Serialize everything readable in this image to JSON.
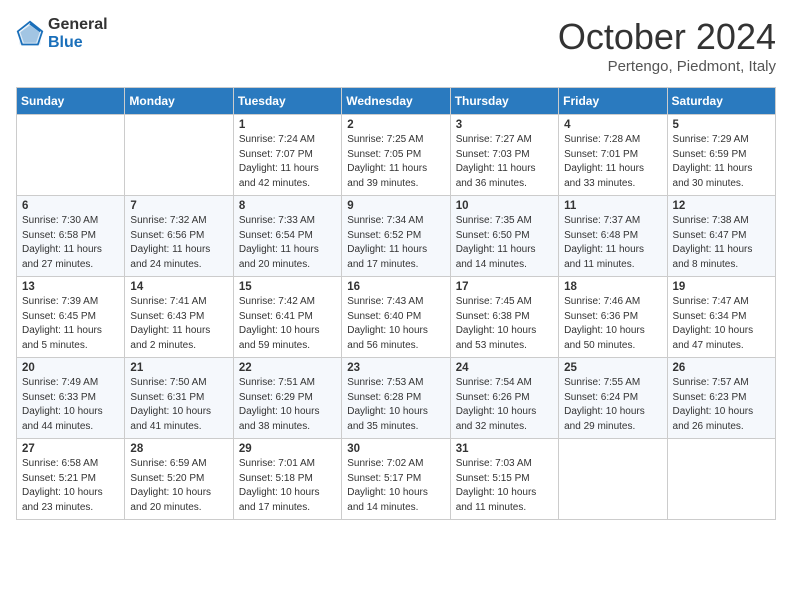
{
  "header": {
    "logo_general": "General",
    "logo_blue": "Blue",
    "title": "October 2024",
    "location": "Pertengo, Piedmont, Italy"
  },
  "columns": [
    "Sunday",
    "Monday",
    "Tuesday",
    "Wednesday",
    "Thursday",
    "Friday",
    "Saturday"
  ],
  "weeks": [
    [
      {
        "day": "",
        "lines": []
      },
      {
        "day": "",
        "lines": []
      },
      {
        "day": "1",
        "lines": [
          "Sunrise: 7:24 AM",
          "Sunset: 7:07 PM",
          "Daylight: 11 hours",
          "and 42 minutes."
        ]
      },
      {
        "day": "2",
        "lines": [
          "Sunrise: 7:25 AM",
          "Sunset: 7:05 PM",
          "Daylight: 11 hours",
          "and 39 minutes."
        ]
      },
      {
        "day": "3",
        "lines": [
          "Sunrise: 7:27 AM",
          "Sunset: 7:03 PM",
          "Daylight: 11 hours",
          "and 36 minutes."
        ]
      },
      {
        "day": "4",
        "lines": [
          "Sunrise: 7:28 AM",
          "Sunset: 7:01 PM",
          "Daylight: 11 hours",
          "and 33 minutes."
        ]
      },
      {
        "day": "5",
        "lines": [
          "Sunrise: 7:29 AM",
          "Sunset: 6:59 PM",
          "Daylight: 11 hours",
          "and 30 minutes."
        ]
      }
    ],
    [
      {
        "day": "6",
        "lines": [
          "Sunrise: 7:30 AM",
          "Sunset: 6:58 PM",
          "Daylight: 11 hours",
          "and 27 minutes."
        ]
      },
      {
        "day": "7",
        "lines": [
          "Sunrise: 7:32 AM",
          "Sunset: 6:56 PM",
          "Daylight: 11 hours",
          "and 24 minutes."
        ]
      },
      {
        "day": "8",
        "lines": [
          "Sunrise: 7:33 AM",
          "Sunset: 6:54 PM",
          "Daylight: 11 hours",
          "and 20 minutes."
        ]
      },
      {
        "day": "9",
        "lines": [
          "Sunrise: 7:34 AM",
          "Sunset: 6:52 PM",
          "Daylight: 11 hours",
          "and 17 minutes."
        ]
      },
      {
        "day": "10",
        "lines": [
          "Sunrise: 7:35 AM",
          "Sunset: 6:50 PM",
          "Daylight: 11 hours",
          "and 14 minutes."
        ]
      },
      {
        "day": "11",
        "lines": [
          "Sunrise: 7:37 AM",
          "Sunset: 6:48 PM",
          "Daylight: 11 hours",
          "and 11 minutes."
        ]
      },
      {
        "day": "12",
        "lines": [
          "Sunrise: 7:38 AM",
          "Sunset: 6:47 PM",
          "Daylight: 11 hours",
          "and 8 minutes."
        ]
      }
    ],
    [
      {
        "day": "13",
        "lines": [
          "Sunrise: 7:39 AM",
          "Sunset: 6:45 PM",
          "Daylight: 11 hours",
          "and 5 minutes."
        ]
      },
      {
        "day": "14",
        "lines": [
          "Sunrise: 7:41 AM",
          "Sunset: 6:43 PM",
          "Daylight: 11 hours",
          "and 2 minutes."
        ]
      },
      {
        "day": "15",
        "lines": [
          "Sunrise: 7:42 AM",
          "Sunset: 6:41 PM",
          "Daylight: 10 hours",
          "and 59 minutes."
        ]
      },
      {
        "day": "16",
        "lines": [
          "Sunrise: 7:43 AM",
          "Sunset: 6:40 PM",
          "Daylight: 10 hours",
          "and 56 minutes."
        ]
      },
      {
        "day": "17",
        "lines": [
          "Sunrise: 7:45 AM",
          "Sunset: 6:38 PM",
          "Daylight: 10 hours",
          "and 53 minutes."
        ]
      },
      {
        "day": "18",
        "lines": [
          "Sunrise: 7:46 AM",
          "Sunset: 6:36 PM",
          "Daylight: 10 hours",
          "and 50 minutes."
        ]
      },
      {
        "day": "19",
        "lines": [
          "Sunrise: 7:47 AM",
          "Sunset: 6:34 PM",
          "Daylight: 10 hours",
          "and 47 minutes."
        ]
      }
    ],
    [
      {
        "day": "20",
        "lines": [
          "Sunrise: 7:49 AM",
          "Sunset: 6:33 PM",
          "Daylight: 10 hours",
          "and 44 minutes."
        ]
      },
      {
        "day": "21",
        "lines": [
          "Sunrise: 7:50 AM",
          "Sunset: 6:31 PM",
          "Daylight: 10 hours",
          "and 41 minutes."
        ]
      },
      {
        "day": "22",
        "lines": [
          "Sunrise: 7:51 AM",
          "Sunset: 6:29 PM",
          "Daylight: 10 hours",
          "and 38 minutes."
        ]
      },
      {
        "day": "23",
        "lines": [
          "Sunrise: 7:53 AM",
          "Sunset: 6:28 PM",
          "Daylight: 10 hours",
          "and 35 minutes."
        ]
      },
      {
        "day": "24",
        "lines": [
          "Sunrise: 7:54 AM",
          "Sunset: 6:26 PM",
          "Daylight: 10 hours",
          "and 32 minutes."
        ]
      },
      {
        "day": "25",
        "lines": [
          "Sunrise: 7:55 AM",
          "Sunset: 6:24 PM",
          "Daylight: 10 hours",
          "and 29 minutes."
        ]
      },
      {
        "day": "26",
        "lines": [
          "Sunrise: 7:57 AM",
          "Sunset: 6:23 PM",
          "Daylight: 10 hours",
          "and 26 minutes."
        ]
      }
    ],
    [
      {
        "day": "27",
        "lines": [
          "Sunrise: 6:58 AM",
          "Sunset: 5:21 PM",
          "Daylight: 10 hours",
          "and 23 minutes."
        ]
      },
      {
        "day": "28",
        "lines": [
          "Sunrise: 6:59 AM",
          "Sunset: 5:20 PM",
          "Daylight: 10 hours",
          "and 20 minutes."
        ]
      },
      {
        "day": "29",
        "lines": [
          "Sunrise: 7:01 AM",
          "Sunset: 5:18 PM",
          "Daylight: 10 hours",
          "and 17 minutes."
        ]
      },
      {
        "day": "30",
        "lines": [
          "Sunrise: 7:02 AM",
          "Sunset: 5:17 PM",
          "Daylight: 10 hours",
          "and 14 minutes."
        ]
      },
      {
        "day": "31",
        "lines": [
          "Sunrise: 7:03 AM",
          "Sunset: 5:15 PM",
          "Daylight: 10 hours",
          "and 11 minutes."
        ]
      },
      {
        "day": "",
        "lines": []
      },
      {
        "day": "",
        "lines": []
      }
    ]
  ]
}
